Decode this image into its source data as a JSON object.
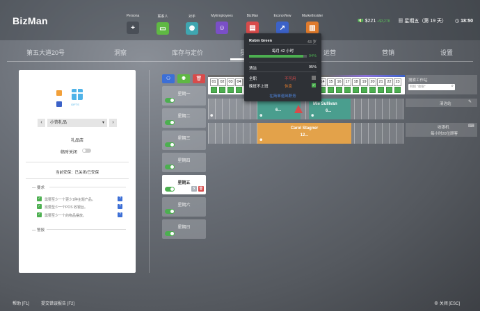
{
  "app": {
    "brand": "BizMan"
  },
  "apps": [
    {
      "label": "Persona",
      "glyph": "+",
      "color": "#4a4f57",
      "icon": "persona-plus-icon"
    },
    {
      "label": "联系人",
      "glyph": "▭",
      "color": "#5fb843",
      "icon": "contacts-icon"
    },
    {
      "label": "对手",
      "glyph": "⚉",
      "color": "#3fa6b0",
      "icon": "competitors-icon"
    },
    {
      "label": "MyEmployees",
      "glyph": "☺",
      "color": "#7a4fc7",
      "icon": "employees-icon"
    },
    {
      "label": "BizMan",
      "glyph": "▤",
      "color": "#d84b4b",
      "icon": "bizman-icon"
    },
    {
      "label": "EconoView",
      "glyph": "↗",
      "color": "#3c62c8",
      "icon": "econoview-icon"
    },
    {
      "label": "MarketInsider",
      "glyph": "▥",
      "color": "#e07b2c",
      "icon": "marketinsider-icon"
    }
  ],
  "status": {
    "money": "$221",
    "money_delta": "+$3,278",
    "date": "星期五（第 19 天）",
    "time": "18:50"
  },
  "nav": [
    "第五大道20号",
    "洞察",
    "库存与定价",
    "员工",
    "运营",
    "营销",
    "设置"
  ],
  "card": {
    "store_name": "礼品店",
    "selector_value": "小饰礼品",
    "temp_closed": "临时关闭",
    "security_status": "当前安保：已关闭/已安保",
    "section_requirements": "要求",
    "requirements": [
      "需要至少一个更少1种主题产品。",
      "需要至少一个POS 收银台。",
      "需要至少一个的物品摆放。"
    ],
    "section_warnings": "警报"
  },
  "days": [
    "星期一",
    "星期二",
    "星期三",
    "星期四",
    "星期五",
    "星期六",
    "星期日"
  ],
  "selected_day": "星期五",
  "hours": [
    "01",
    "02",
    "03",
    "04",
    "05",
    "06",
    "07",
    "08",
    "09",
    "10",
    "11",
    "12",
    "13",
    "14",
    "15",
    "16",
    "17",
    "18",
    "19",
    "20",
    "21",
    "22",
    "23"
  ],
  "schedule": {
    "row1_label": "6...",
    "row1_right_label": "Mie Sullivan",
    "row1_right_sub": "6...",
    "row2_label": "Carol Stagner",
    "row2_sub": "12..."
  },
  "side_panel": {
    "workstation_search_title": "搜索工作站",
    "search_placeholder": "例如 \"收银\"",
    "cleaning_station": "清洁站",
    "checkout_title": "收银机",
    "checkout_rate": "每小时20位顾客"
  },
  "popup": {
    "name": "Robin Green",
    "age": "43 岁",
    "rate": "每月 42 小时",
    "rate_pct": "94%",
    "cleaning_label": "清洁",
    "cleaning_value": "95%",
    "full_time": "全职",
    "full_time_tag": "不可用",
    "night_shift": "晚班不上班",
    "night_tag": "休息",
    "more": "在简单退出职务",
    "bar_fill": 0.94
  },
  "footer": {
    "help": "帮助 [F1]",
    "report": "提交错误报告 [F2]",
    "close": "关闭 [ESC]"
  }
}
